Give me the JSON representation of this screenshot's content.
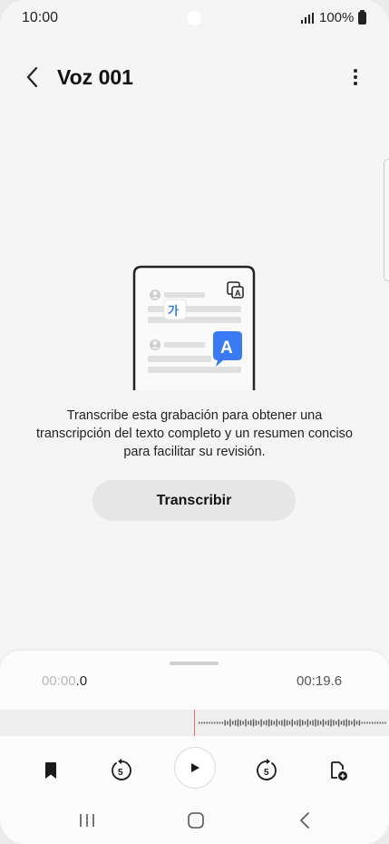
{
  "status_bar": {
    "time": "10:00",
    "battery": "100%"
  },
  "header": {
    "title": "Voz 001"
  },
  "main": {
    "description_lines": [
      "Transcribe esta grabación para obtener una",
      "transcripción del texto completo y un resumen conciso",
      "para facilitar su revisión."
    ],
    "transcribe_button": "Transcribir",
    "illustration": {
      "korean_glyph": "가",
      "latin_glyph": "A"
    }
  },
  "player": {
    "elapsed_dim": "00:00",
    "elapsed_bright": ".0",
    "duration": "00:19.6",
    "skip_back_seconds": "5",
    "skip_forward_seconds": "5"
  },
  "colors": {
    "accent_blue": "#3a7af5",
    "wave_teal": "#2ccfbf",
    "wave_blue": "#3a7af5",
    "playhead_red": "#f06a6a"
  },
  "icons": {
    "back": "chevron-left-icon",
    "more": "more-vertical-icon",
    "bookmark": "bookmark-icon",
    "skip_back": "rewind-5-icon",
    "play": "play-icon",
    "skip_forward": "forward-5-icon",
    "add_note": "add-note-icon",
    "recents": "recents-icon",
    "home": "home-icon",
    "back_nav": "back-nav-icon"
  }
}
